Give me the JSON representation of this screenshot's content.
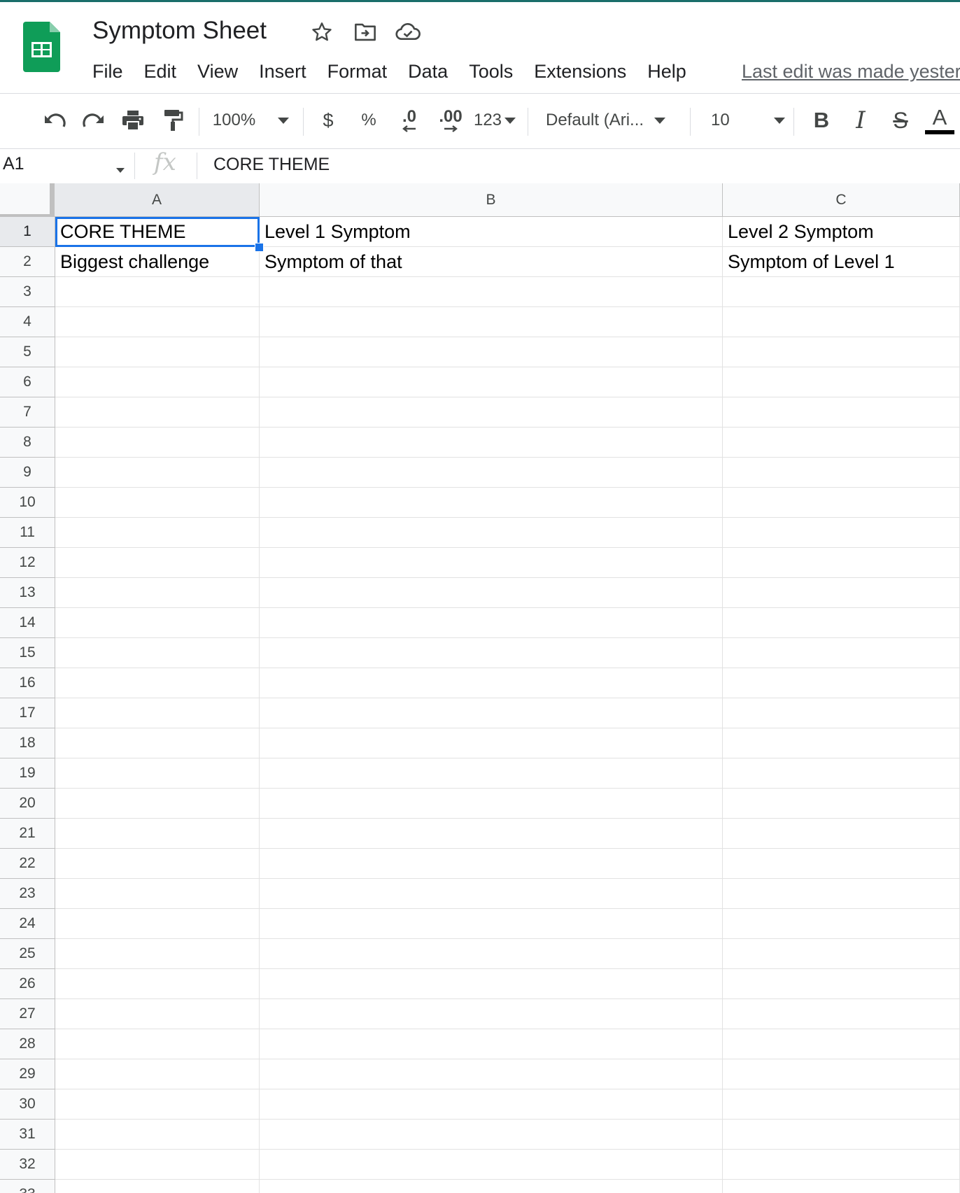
{
  "document": {
    "title": "Symptom Sheet",
    "last_edit": "Last edit was made yesterday"
  },
  "menu": [
    "File",
    "Edit",
    "View",
    "Insert",
    "Format",
    "Data",
    "Tools",
    "Extensions",
    "Help"
  ],
  "toolbar": {
    "zoom": "100%",
    "currency": "$",
    "percent": "%",
    "decrease_decimal": ".0",
    "increase_decimal": ".00",
    "more_formats": "123",
    "font": "Default (Ari...",
    "font_size": "10",
    "bold": "B",
    "italic": "I",
    "strikethrough": "S",
    "text_color_label": "A",
    "text_color": "#000000"
  },
  "formula_bar": {
    "cell_ref": "A1",
    "fx": "fx",
    "value": "CORE THEME"
  },
  "sheet": {
    "columns": [
      "A",
      "B",
      "C"
    ],
    "row_count": 33,
    "rows": [
      [
        "CORE THEME",
        "Level 1 Symptom",
        "Level 2 Symptom"
      ],
      [
        "Biggest challenge",
        "Symptom of that",
        "Symptom of Level 1"
      ]
    ],
    "selected_cell": "A1",
    "selection_color": "#1a73e8"
  },
  "icons": {
    "logo": "sheets-logo-icon",
    "star": "star-icon",
    "move": "move-to-folder-icon",
    "cloud": "cloud-saved-icon",
    "undo": "undo-icon",
    "redo": "redo-icon",
    "print": "print-icon",
    "paint": "paint-format-icon"
  }
}
